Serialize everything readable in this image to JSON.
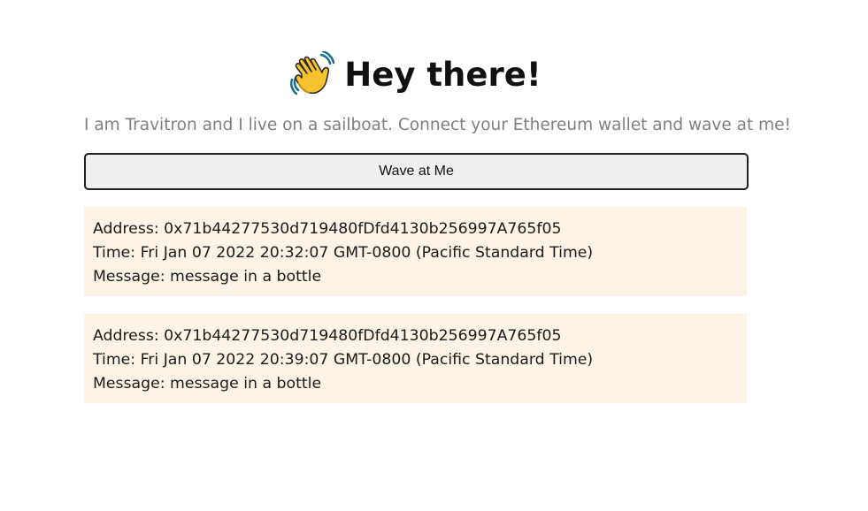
{
  "header": {
    "emoji": "👋",
    "title": "Hey there!"
  },
  "bio": "I am Travitron and I live on a sailboat. Connect your Ethereum wallet and wave at me!",
  "wave_button_label": "Wave at Me",
  "waves": [
    {
      "address_line": "Address: 0x71b44277530d719480fDfd4130b256997A765f05",
      "time_line": "Time: Fri Jan 07 2022 20:32:07 GMT-0800 (Pacific Standard Time)",
      "message_line": "Message: message in a bottle"
    },
    {
      "address_line": "Address: 0x71b44277530d719480fDfd4130b256997A765f05",
      "time_line": "Time: Fri Jan 07 2022 20:39:07 GMT-0800 (Pacific Standard Time)",
      "message_line": "Message: message in a bottle"
    }
  ],
  "colors": {
    "card_background": "#fdf4e5",
    "bio_text": "#808080",
    "button_background": "#efefef",
    "button_border": "#1f1f1f",
    "emoji_hand": "#f8c22e"
  },
  "icons": {
    "header_icon": "waving-hand-icon"
  }
}
